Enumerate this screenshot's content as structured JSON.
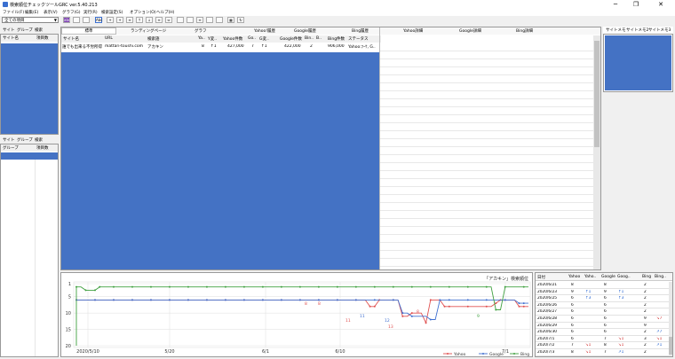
{
  "window": {
    "title": "検索順位チェックツールGRC  ver.5.40.213",
    "minimize": "─",
    "restore": "❐",
    "close": "✕"
  },
  "menu": [
    "ファイル(F)",
    "編集(E)",
    "表示(V)",
    "グラフ(G)",
    "実行(R)",
    "検索設定(S)",
    "オプション(O)",
    "ヘルプ(H)"
  ],
  "toolbar": {
    "filter_value": "全ての項目",
    "buttons": [
      "abc",
      "",
      "",
      "Abc",
      "+",
      "+",
      "≡",
      "↑",
      "↓",
      "≡",
      "⇔",
      "",
      "",
      "≡",
      "",
      "",
      "▦",
      "↻"
    ]
  },
  "left_top": {
    "tabs": [
      "サイト",
      "グループ",
      "検索"
    ],
    "columns": [
      "サイト名",
      "項目数"
    ]
  },
  "left_bottom": {
    "tabs": [
      "サイト",
      "グループ",
      "検索"
    ],
    "columns": [
      "グループ",
      "項目数"
    ]
  },
  "main": {
    "group_headers": [
      "標準",
      "ランディングページ",
      "グラフ",
      "Yahoo!履歴",
      "Google履歴",
      "Bing履歴",
      "Yahoo詳細",
      "Google詳細",
      "Bing詳細"
    ],
    "columns": [
      "サイト名",
      "URL",
      "検索語",
      "Ya..",
      "Y変..",
      "Yahoo件数",
      "Go..",
      "G変..",
      "Google件数",
      "Bin..",
      "B..",
      "Bing件数",
      "ステータス"
    ],
    "row": [
      "誰でも出来る不労所得",
      "mattari-toushi.com",
      "アカキン",
      "8",
      "↑1",
      "427,000",
      "7",
      "↑1",
      "422,000",
      "2",
      "",
      "906,000",
      "Yahoo:ﾌｰｹ, G.."
    ]
  },
  "right_panel": {
    "tabs": [
      "サイトメモ",
      "サイトメモ2",
      "サイトメモ3"
    ]
  },
  "chart_data": {
    "type": "line",
    "title": "「アカキン」検索順位",
    "y_ticks": [
      "1",
      "5",
      "10",
      "15",
      "20"
    ],
    "x_ticks": [
      "2020/5/10",
      "5/20",
      "6/1",
      "6/10",
      "7/1"
    ],
    "ylim": [
      1,
      20
    ],
    "legend": [
      "Yahoo",
      "Google",
      "Bing"
    ],
    "legend_placement": "bottom-right",
    "colors": {
      "Yahoo": "#e05050",
      "Google": "#4070d0",
      "Bing": "#40a040"
    },
    "series": [
      {
        "name": "Yahoo",
        "values": [
          6,
          6,
          6,
          6,
          6,
          6,
          6,
          6,
          6,
          6,
          6,
          6,
          6,
          6,
          6,
          6,
          6,
          6,
          6,
          6,
          6,
          6,
          6,
          6,
          6,
          6,
          6,
          6,
          6,
          6,
          6,
          6,
          6,
          6,
          6,
          6,
          6,
          6,
          6,
          6,
          6,
          6,
          6,
          6,
          6,
          6,
          6,
          6,
          6,
          6,
          6,
          6,
          6,
          6,
          6,
          6,
          6,
          6,
          6,
          6,
          6,
          6,
          6,
          8,
          8,
          6,
          6,
          6,
          6,
          6,
          11,
          11,
          10,
          10,
          10,
          13,
          6,
          6,
          6,
          8,
          8,
          8,
          8,
          8,
          8,
          8,
          8,
          8,
          8,
          8,
          7,
          6,
          6,
          6,
          6,
          8,
          8,
          8
        ]
      },
      {
        "name": "Google",
        "values": [
          6,
          6,
          6,
          6,
          6,
          6,
          6,
          6,
          6,
          6,
          6,
          6,
          6,
          6,
          6,
          6,
          6,
          6,
          6,
          6,
          6,
          6,
          6,
          6,
          6,
          6,
          6,
          6,
          6,
          6,
          6,
          6,
          6,
          6,
          6,
          6,
          6,
          6,
          6,
          6,
          6,
          6,
          6,
          6,
          6,
          6,
          6,
          6,
          6,
          6,
          6,
          6,
          6,
          6,
          6,
          6,
          6,
          6,
          6,
          6,
          6,
          6,
          6,
          6,
          6,
          6,
          6,
          6,
          6,
          6,
          10,
          10,
          11,
          11,
          11,
          11,
          12,
          12,
          6,
          6,
          6,
          6,
          6,
          6,
          6,
          6,
          6,
          6,
          6,
          6,
          6,
          6,
          6,
          6,
          6,
          7,
          7,
          7
        ]
      },
      {
        "name": "Bing",
        "values": [
          2,
          2,
          3,
          3,
          3,
          2,
          2,
          2,
          2,
          2,
          2,
          2,
          2,
          2,
          2,
          2,
          2,
          2,
          2,
          2,
          2,
          2,
          2,
          2,
          2,
          2,
          2,
          2,
          2,
          2,
          2,
          2,
          2,
          2,
          2,
          2,
          2,
          2,
          2,
          2,
          2,
          2,
          2,
          2,
          2,
          2,
          2,
          2,
          2,
          2,
          2,
          2,
          2,
          2,
          2,
          2,
          2,
          2,
          2,
          2,
          2,
          2,
          2,
          2,
          2,
          2,
          2,
          2,
          2,
          2,
          2,
          2,
          2,
          2,
          2,
          2,
          2,
          2,
          2,
          2,
          2,
          2,
          2,
          2,
          2,
          2,
          2,
          2,
          2,
          2,
          9,
          9,
          2,
          2,
          2,
          2,
          2,
          2
        ]
      }
    ],
    "labels": [
      {
        "series": "Yahoo",
        "text": "8"
      },
      {
        "series": "Yahoo",
        "text": "8"
      },
      {
        "series": "Yahoo",
        "text": "11"
      },
      {
        "series": "Yahoo",
        "text": "13"
      },
      {
        "series": "Google",
        "text": "11"
      },
      {
        "series": "Google",
        "text": "12"
      },
      {
        "series": "Yahoo",
        "text": "8"
      },
      {
        "series": "Bing",
        "text": "9"
      }
    ]
  },
  "history": {
    "columns": [
      "日付",
      "Yahoo",
      "Yaho..",
      "Google",
      "Goog..",
      "Bing",
      "Bing.."
    ],
    "rows": [
      [
        "2020/6/21",
        "8",
        "",
        "8",
        "",
        "2",
        ""
      ],
      [
        "2020/6/23",
        "9",
        "↑1",
        "9",
        "↑1",
        "2",
        ""
      ],
      [
        "2020/6/25",
        "6",
        "↑3",
        "6",
        "↑3",
        "2",
        ""
      ],
      [
        "2020/6/26",
        "6",
        "",
        "6",
        "",
        "2",
        ""
      ],
      [
        "2020/6/27",
        "6",
        "",
        "6",
        "",
        "2",
        ""
      ],
      [
        "2020/6/28",
        "6",
        "",
        "6",
        "",
        "9",
        "↘7"
      ],
      [
        "2020/6/29",
        "6",
        "",
        "6",
        "",
        "9",
        ""
      ],
      [
        "2020/6/30",
        "6",
        "",
        "6",
        "",
        "2",
        "↗7"
      ],
      [
        "2020/7/1",
        "6",
        "",
        "7",
        "↘1",
        "3",
        "↘1"
      ],
      [
        "2020/7/2",
        "7",
        "↘1",
        "8",
        "↘1",
        "2",
        "↗1"
      ],
      [
        "2020/7/3",
        "8",
        "↘1",
        "7",
        "↗1",
        "2",
        ""
      ]
    ]
  }
}
